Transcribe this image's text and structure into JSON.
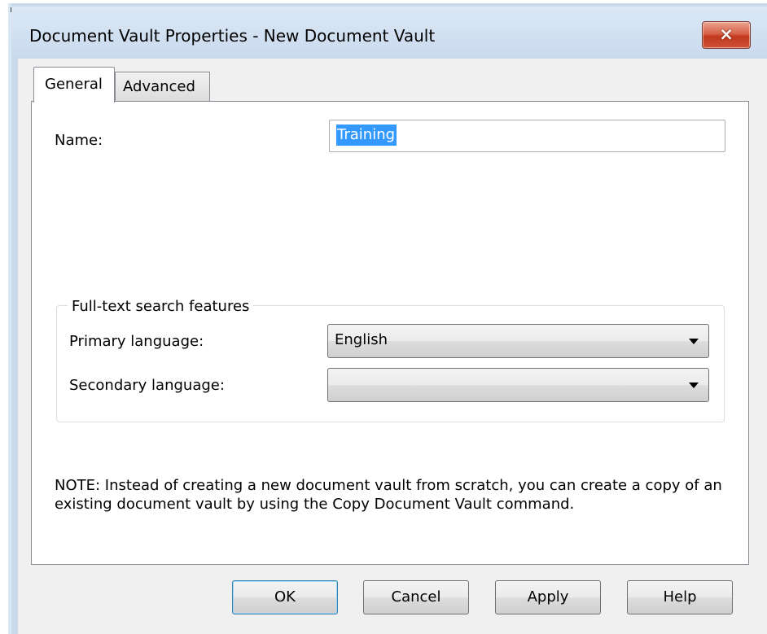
{
  "window": {
    "title": "Document Vault Properties - New Document Vault",
    "close_label": "×"
  },
  "tabs": [
    {
      "label": "General",
      "selected": true
    },
    {
      "label": "Advanced",
      "selected": false
    }
  ],
  "general": {
    "name_label": "Name:",
    "name_value": "Training",
    "fulltext_group_title": "Full-text search features",
    "primary_language_label": "Primary language:",
    "primary_language_value": "English",
    "secondary_language_label": "Secondary language:",
    "secondary_language_value": "",
    "note": "NOTE: Instead of creating a new document vault from scratch, you can create a copy of an existing document vault by using the Copy Document Vault command."
  },
  "buttons": {
    "ok": "OK",
    "cancel": "Cancel",
    "apply": "Apply",
    "help": "Help"
  },
  "colors": {
    "selection": "#3399ff",
    "close_button": "#c0391f",
    "titlebar": "#c9daed"
  }
}
